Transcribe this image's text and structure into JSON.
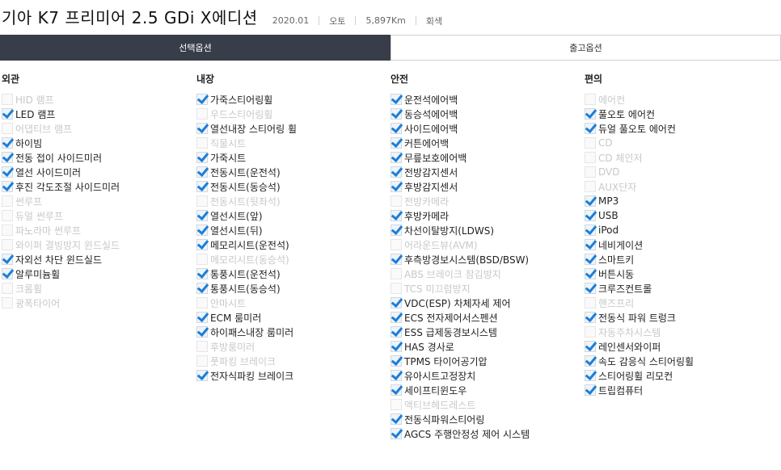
{
  "header": {
    "title": "기아 K7 프리미어 2.5 GDi X에디션",
    "year": "2020.01",
    "transmission": "오토",
    "mileage": "5,897Km",
    "color": "회색"
  },
  "tabs": [
    {
      "label": "선택옵션",
      "active": true
    },
    {
      "label": "출고옵션",
      "active": false
    }
  ],
  "columns": [
    {
      "title": "외관",
      "items": [
        {
          "label": "HID 램프",
          "checked": false
        },
        {
          "label": "LED 램프",
          "checked": true
        },
        {
          "label": "어댑티브 램프",
          "checked": false
        },
        {
          "label": "하이빔",
          "checked": true
        },
        {
          "label": "전동 접이 사이드미러",
          "checked": true
        },
        {
          "label": "열선 사이드미러",
          "checked": true
        },
        {
          "label": "후진 각도조절 사이드미러",
          "checked": true
        },
        {
          "label": "썬루프",
          "checked": false
        },
        {
          "label": "듀얼 썬루프",
          "checked": false
        },
        {
          "label": "파노라마 썬루프",
          "checked": false
        },
        {
          "label": "와이퍼 결빙방지 윈드실드",
          "checked": false
        },
        {
          "label": "자외선 차단 윈드실드",
          "checked": true
        },
        {
          "label": "알루미늄휠",
          "checked": true
        },
        {
          "label": "크롬휠",
          "checked": false
        },
        {
          "label": "광폭타이어",
          "checked": false
        }
      ]
    },
    {
      "title": "내장",
      "items": [
        {
          "label": "가죽스티어링휠",
          "checked": true
        },
        {
          "label": "우드스티어링휠",
          "checked": false
        },
        {
          "label": "열선내장 스티어링 휠",
          "checked": true
        },
        {
          "label": "직물시트",
          "checked": false
        },
        {
          "label": "가죽시트",
          "checked": true
        },
        {
          "label": "전동시트(운전석)",
          "checked": true
        },
        {
          "label": "전동시트(동승석)",
          "checked": true
        },
        {
          "label": "전동시트(뒷좌석)",
          "checked": false
        },
        {
          "label": "열선시트(앞)",
          "checked": true
        },
        {
          "label": "열선시트(뒤)",
          "checked": true
        },
        {
          "label": "메모리시트(운전석)",
          "checked": true
        },
        {
          "label": "메모리시트(동승석)",
          "checked": false
        },
        {
          "label": "통풍시트(운전석)",
          "checked": true
        },
        {
          "label": "통풍시트(동승석)",
          "checked": true
        },
        {
          "label": "안마시트",
          "checked": false
        },
        {
          "label": "ECM 룸미러",
          "checked": true
        },
        {
          "label": "하이패스내장 룸미러",
          "checked": true
        },
        {
          "label": "후방룸미러",
          "checked": false
        },
        {
          "label": "풋파킹 브레이크",
          "checked": false
        },
        {
          "label": "전자식파킹 브레이크",
          "checked": true
        }
      ]
    },
    {
      "title": "안전",
      "items": [
        {
          "label": "운전석에어백",
          "checked": true
        },
        {
          "label": "동승석에어백",
          "checked": true
        },
        {
          "label": "사이드에어백",
          "checked": true
        },
        {
          "label": "커튼에어백",
          "checked": true
        },
        {
          "label": "무릎보호에어백",
          "checked": true
        },
        {
          "label": "전방감지센서",
          "checked": true
        },
        {
          "label": "후방감지센서",
          "checked": true
        },
        {
          "label": "전방카메라",
          "checked": false
        },
        {
          "label": "후방카메라",
          "checked": true
        },
        {
          "label": "차선이탈방지(LDWS)",
          "checked": true
        },
        {
          "label": "어라운드뷰(AVM)",
          "checked": false
        },
        {
          "label": "후측방경보시스템(BSD/BSW)",
          "checked": true
        },
        {
          "label": "ABS 브레이크 잠김방지",
          "checked": false
        },
        {
          "label": "TCS 미끄럼방지",
          "checked": false
        },
        {
          "label": "VDC(ESP) 차체자세 제어",
          "checked": true
        },
        {
          "label": "ECS 전자제어서스펜션",
          "checked": true
        },
        {
          "label": "ESS 급제동경보시스템",
          "checked": true
        },
        {
          "label": "HAS 경사로",
          "checked": true
        },
        {
          "label": "TPMS 타이어공기압",
          "checked": true
        },
        {
          "label": "유아시트고정장치",
          "checked": true
        },
        {
          "label": "세이프티윈도우",
          "checked": true
        },
        {
          "label": "액티브헤드레스트",
          "checked": false
        },
        {
          "label": "전동식파워스티어링",
          "checked": true
        },
        {
          "label": "AGCS 주행안정성 제어 시스템",
          "checked": true
        }
      ]
    },
    {
      "title": "편의",
      "items": [
        {
          "label": "에어컨",
          "checked": false
        },
        {
          "label": "풀오토 에어컨",
          "checked": true
        },
        {
          "label": "듀얼 풀오토 에어컨",
          "checked": true
        },
        {
          "label": "CD",
          "checked": false
        },
        {
          "label": "CD 체인저",
          "checked": false
        },
        {
          "label": "DVD",
          "checked": false
        },
        {
          "label": "AUX단자",
          "checked": false
        },
        {
          "label": "MP3",
          "checked": true
        },
        {
          "label": "USB",
          "checked": true
        },
        {
          "label": "iPod",
          "checked": true
        },
        {
          "label": "네비게이션",
          "checked": true
        },
        {
          "label": "스마트키",
          "checked": true
        },
        {
          "label": "버튼시동",
          "checked": true
        },
        {
          "label": "크루즈컨트롤",
          "checked": true
        },
        {
          "label": "핸즈프리",
          "checked": false
        },
        {
          "label": "전동식 파워 트렁크",
          "checked": true
        },
        {
          "label": "자동주차시스템",
          "checked": false
        },
        {
          "label": "레인센서와이퍼",
          "checked": true
        },
        {
          "label": "속도 감응식 스티어링휠",
          "checked": true
        },
        {
          "label": "스티어링휠 리모컨",
          "checked": true
        },
        {
          "label": "트립컴퓨터",
          "checked": true
        }
      ]
    }
  ]
}
